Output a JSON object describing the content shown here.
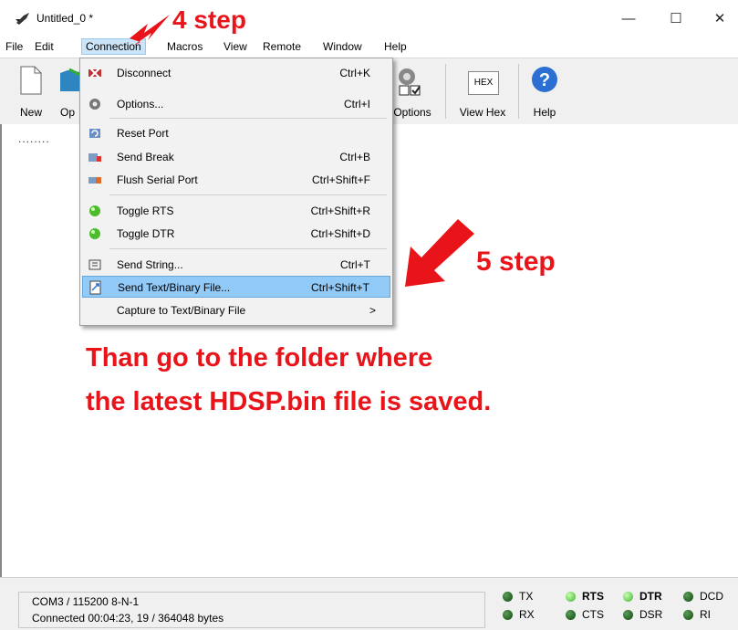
{
  "window": {
    "title": "Untitled_0 *"
  },
  "menubar": [
    "File",
    "Edit",
    "Connection",
    "Macros",
    "View",
    "Remote",
    "Window",
    "Help"
  ],
  "toolbar": {
    "new": "New",
    "open": "Op",
    "options": "Options",
    "hex_icon": "HEX",
    "view_hex": "View Hex",
    "help": "Help"
  },
  "terminal": {
    "cursor_text": "........"
  },
  "connection_menu": [
    {
      "label": "Disconnect",
      "shortcut": "Ctrl+K",
      "icon": "disconnect-icon"
    },
    {
      "label": "Options...",
      "shortcut": "Ctrl+I",
      "icon": "gear-icon"
    },
    {
      "label": "Reset Port",
      "shortcut": "",
      "icon": "reset-port-icon"
    },
    {
      "label": "Send Break",
      "shortcut": "Ctrl+B",
      "icon": "send-break-icon"
    },
    {
      "label": "Flush Serial Port",
      "shortcut": "Ctrl+Shift+F",
      "icon": "flush-port-icon"
    },
    {
      "label": "Toggle RTS",
      "shortcut": "Ctrl+Shift+R",
      "icon": "green-led-icon"
    },
    {
      "label": "Toggle DTR",
      "shortcut": "Ctrl+Shift+D",
      "icon": "green-led-icon"
    },
    {
      "label": "Send String...",
      "shortcut": "Ctrl+T",
      "icon": "send-string-icon"
    },
    {
      "label": "Send Text/Binary File...",
      "shortcut": "Ctrl+Shift+T",
      "icon": "send-file-icon"
    },
    {
      "label": "Capture to Text/Binary File",
      "shortcut": ">",
      "icon": ""
    }
  ],
  "annotations": {
    "step4": "4 step",
    "step5": "5 step",
    "line1": "Than go to the folder where",
    "line2": "the latest HDSP.bin file is saved."
  },
  "status": {
    "port": "COM3 / 115200 8-N-1",
    "connected": "Connected 00:04:23, 19 / 364048 bytes",
    "leds": {
      "tx": "TX",
      "rx": "RX",
      "rts": "RTS",
      "cts": "CTS",
      "dtr": "DTR",
      "dsr": "DSR",
      "dcd": "DCD",
      "ri": "RI"
    }
  },
  "colors": {
    "annotation_red": "#e8141a",
    "menu_highlight": "#91c9f7"
  }
}
